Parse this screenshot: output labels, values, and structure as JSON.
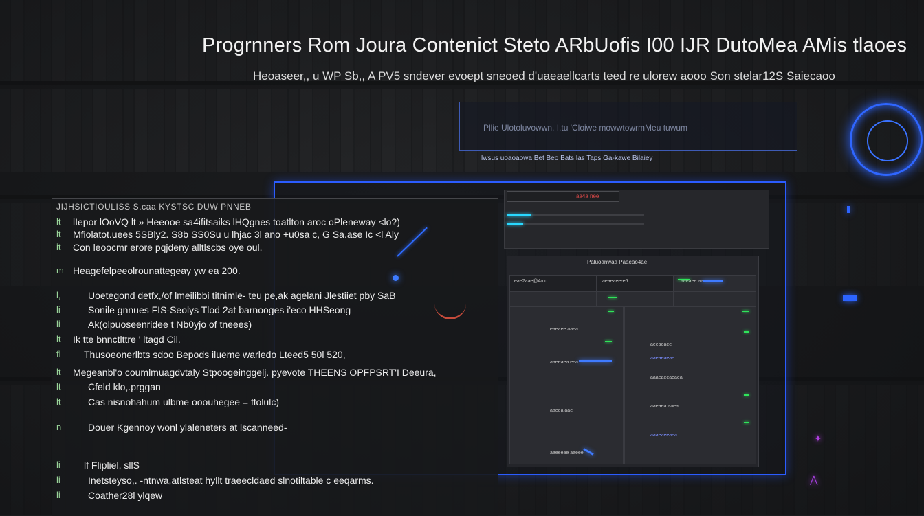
{
  "header": {
    "headline": "Progrnners Rom Joura Contenict Steto ARbUofis I00 IJR DutoMea AMis tlaoes",
    "subline": "Heoaseer,, u WP Sb,, A PV5 sndever evoept sneoed d'uaeaellcarts teed re ulorew aooo Son stelar12S Saiecaoo"
  },
  "info_box": {
    "text": "Pllie Ulotoluvowwn. I.tu 'Cloiwe mowwtowrmMeu tuwum",
    "caption": "lwsus uoaoaowa Bet Beo  Bats las  Taps Ga-kawe Bilaiey"
  },
  "editor": {
    "title": "JIJHSICTIOULISS S.caa  KYSTSC DUW PNNEB",
    "lines": [
      {
        "gutter": "lt",
        "text": "lIepor lOoVQ lt  » Heeooe sa4ifitsaiks  lHQgnes toatlton  aroc oPleneway  <lo?)"
      },
      {
        "gutter": "lt",
        "text": "Mfiolatot.uees  5SBly2. S8b  SS0Su u  lhjac 3l ano  +u0sa  c, G Sa.ase Ic <l Aly"
      },
      {
        "gutter": "it",
        "text": "Con leoocmr erore  pqjdeny alltlscbs  oye oul."
      },
      {
        "gutter": "m",
        "text": "Heagefelpeeolrounattegeay yw ea 200."
      },
      {
        "gutter": "l,",
        "text": "Uoetegond detfx,/of lmeilibbi titnimle- teu pe,ak agelani Jlestiiet pby SaB"
      },
      {
        "gutter": "li",
        "text": "Sonile gnnues FIS-Seolys Tlod 2at barnooges i'eco HHSeong"
      },
      {
        "gutter": "li",
        "text": "Ak(olpuoseenridee t Nb0yjo of tneees)"
      },
      {
        "gutter": "lt",
        "text": "Ik tte  bnnctlttre ' ltagd Cil."
      },
      {
        "gutter": "fl",
        "text": "Thusoeonerlbts sdoo Bepods ilueme warledo  Lteed5  50l  520,"
      },
      {
        "gutter": "lt",
        "text": "Megeanbl'o coumlmuagdvtaly Stpoogeinggelj. pyevote THEENS OPFPSRT'I Deeura,"
      },
      {
        "gutter": "lt",
        "text": "Cfeld klo,.prggan"
      },
      {
        "gutter": "lt",
        "text": "Cas nisnohahum ulbme ooouhegee = ffolulc)"
      },
      {
        "gutter": "n",
        "text": "Douer Kgennoy wonl ylaleneters at lscanneed-"
      },
      {
        "gutter": "li",
        "text": "lf Flipliel, sllS"
      },
      {
        "gutter": "li",
        "text": "Inetsteyso,. -ntnwa,atlsteat hyllt traeecldaed slnotiltable  c eeqarms."
      },
      {
        "gutter": "li",
        "text": "Coather28l ylqew"
      }
    ]
  },
  "dashboard": {
    "tab_label": "aa4a nee",
    "title": "Paluoanwaa Paaeao4ae",
    "header_labels": [
      "eae2aae@4a.o",
      "aeaeaee-e6",
      "aeeaee aaea"
    ],
    "row_labels": [
      "eaeaee aaea",
      "aaeeaea eea",
      "aaeea aae",
      "aaeeeae aaeee"
    ],
    "right_labels": [
      "aeeaeaee",
      "aaeaeaeae",
      "aaaeaeeaeaea",
      "aaeaea aaea",
      "aaaeaeeaea"
    ],
    "progress": [
      0.18,
      0.12
    ]
  },
  "colors": {
    "accent_blue": "#2b5cff",
    "code_gutter": "#9ad59a",
    "spark_green": "#2fe35a",
    "cyan": "#29d8ff"
  }
}
